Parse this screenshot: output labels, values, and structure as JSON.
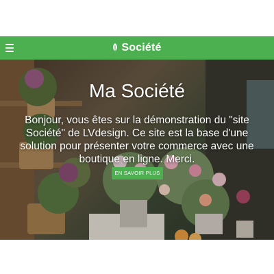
{
  "header": {
    "brand": "Société",
    "accent_color": "#4caf50",
    "menu_icon": "hamburger-menu-icon",
    "logo_icon": "leaf-icon"
  },
  "hero": {
    "title": "Ma Société",
    "text": "Bonjour, vous êtes sur la démonstration du \"site Société\" de LVdesign. Ce site est la base d'une solution pour présenter votre commerce avec une boutique en ligne. Merci.",
    "cta_label": "EN SAVOIR PLUS"
  }
}
